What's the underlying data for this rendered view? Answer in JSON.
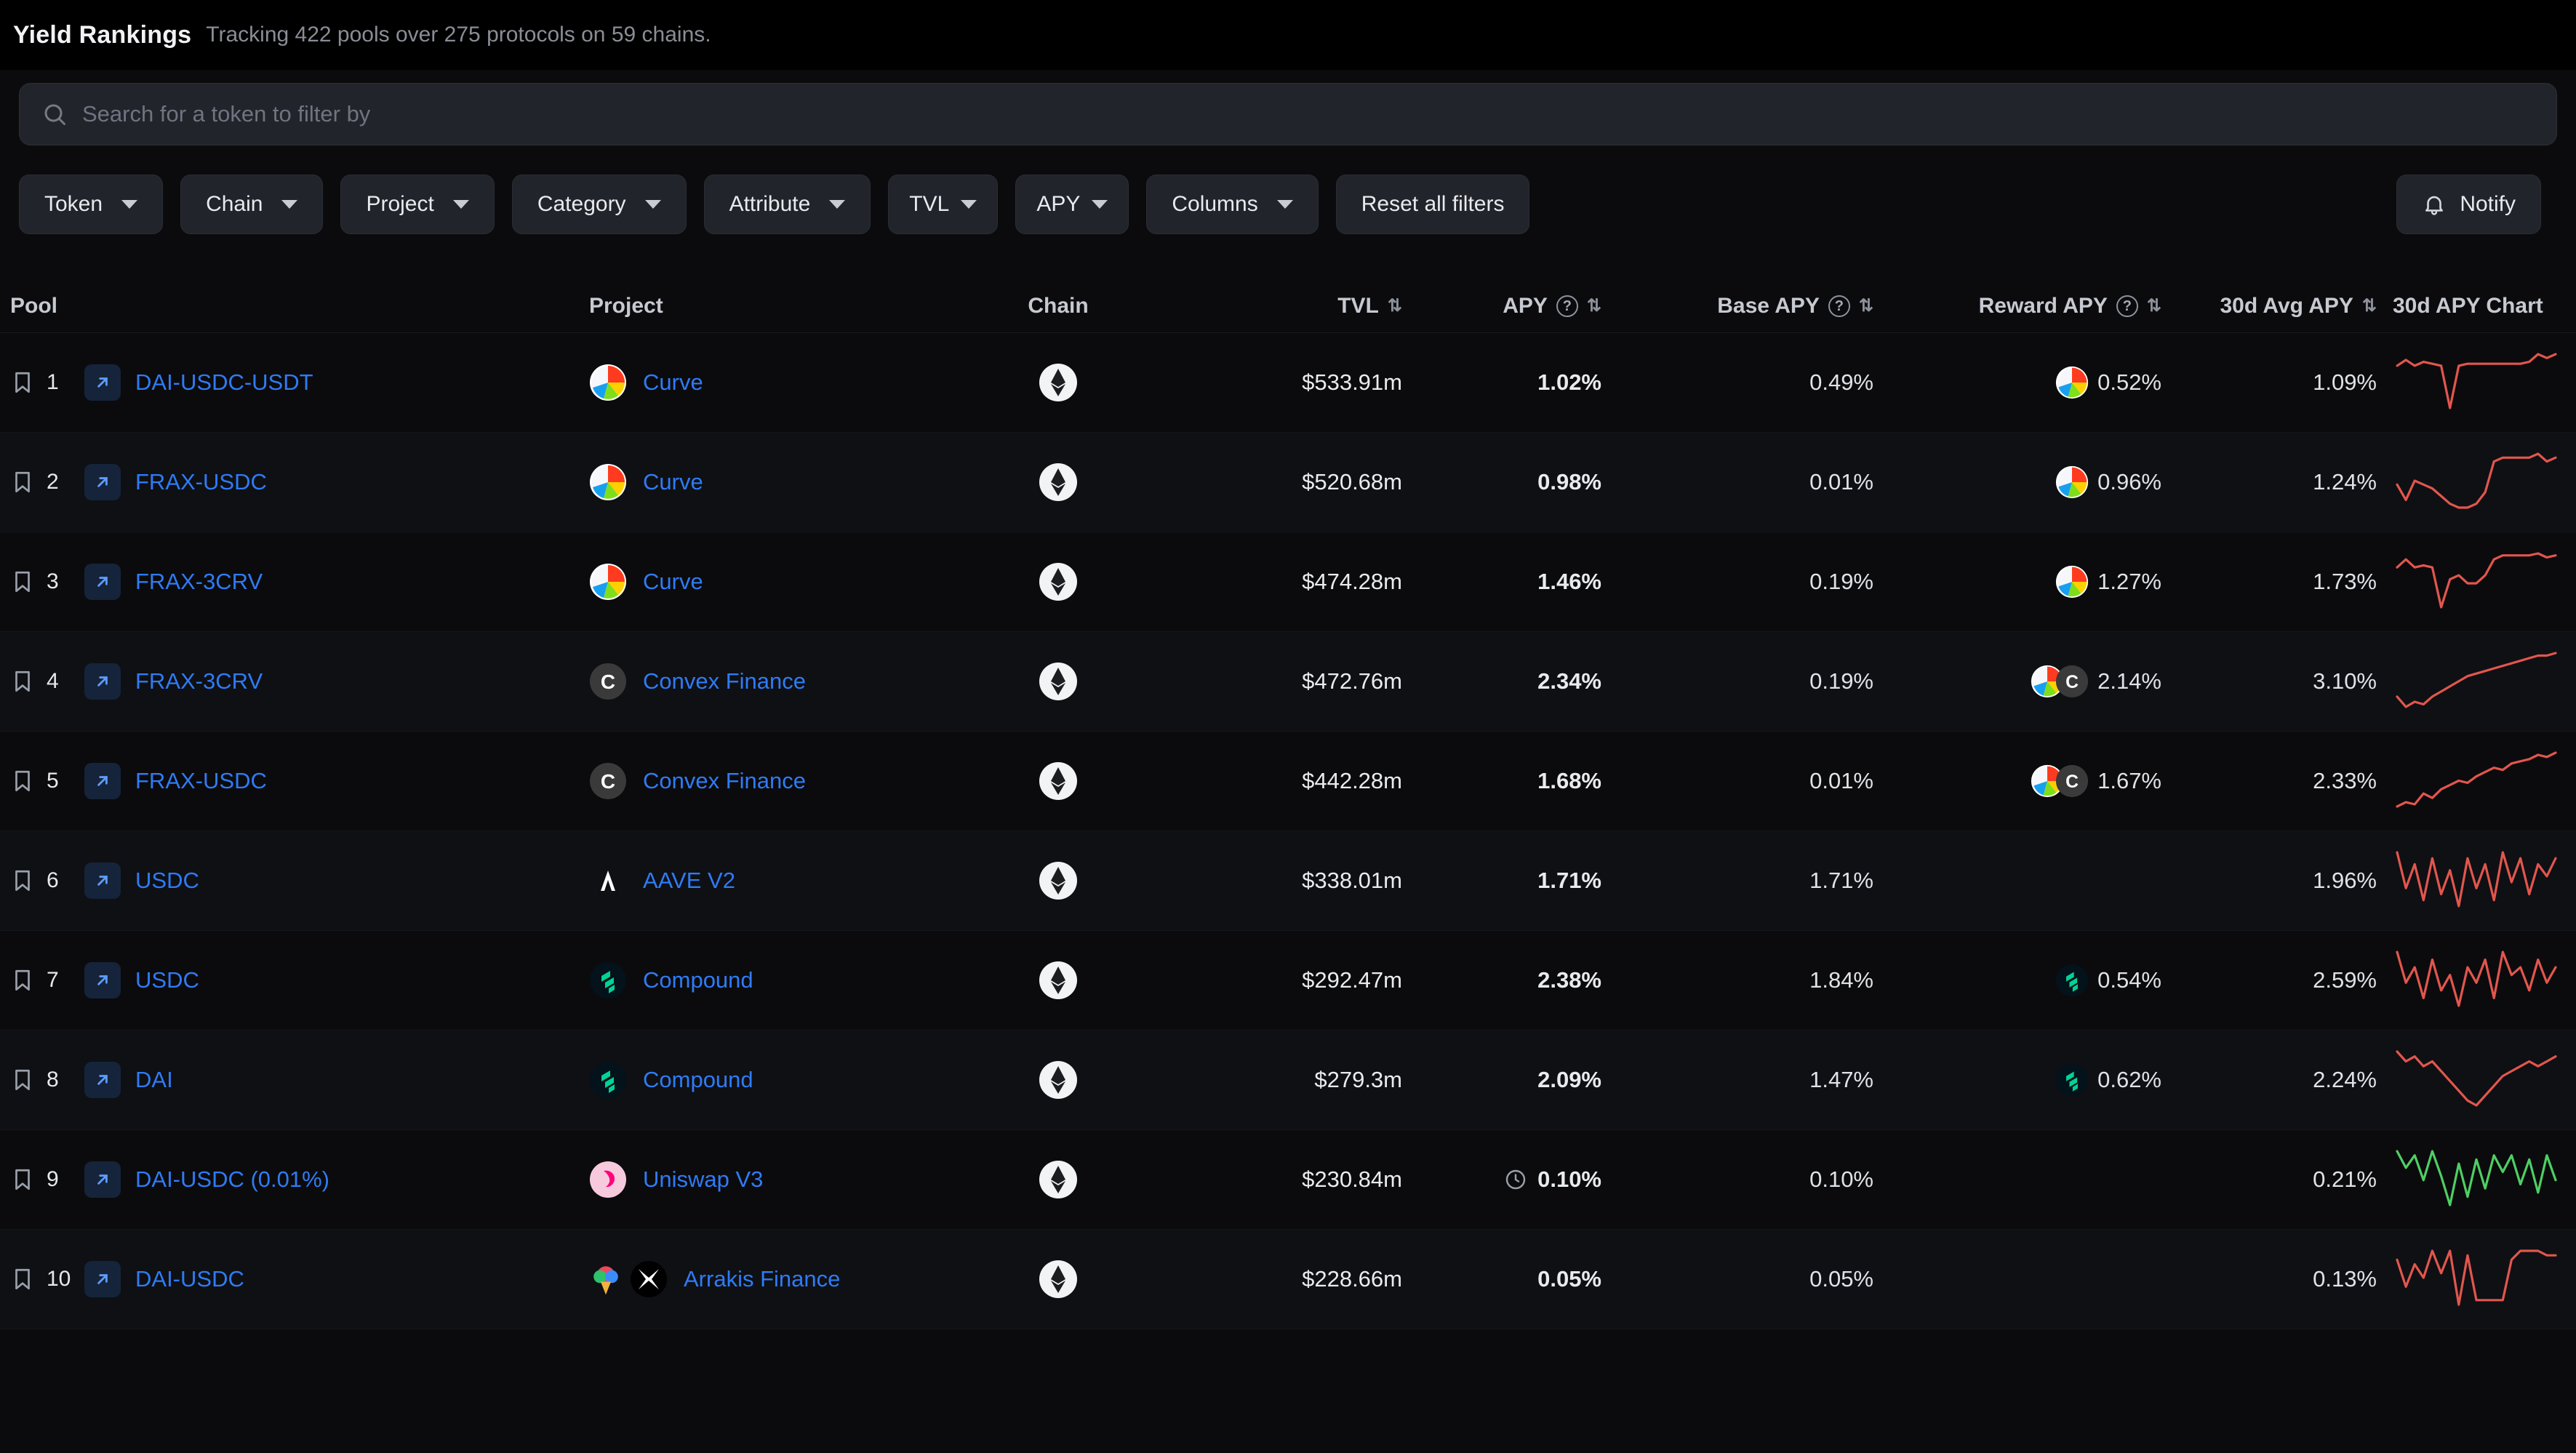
{
  "header": {
    "title": "Yield Rankings",
    "subtitle": "Tracking 422 pools over 275 protocols on 59 chains."
  },
  "search": {
    "placeholder": "Search for a token to filter by",
    "value": "",
    "icon": "search-icon"
  },
  "filters": {
    "chips": [
      {
        "label": "Token",
        "caret": true
      },
      {
        "label": "Chain",
        "caret": true
      },
      {
        "label": "Project",
        "caret": true
      },
      {
        "label": "Category",
        "caret": true
      },
      {
        "label": "Attribute",
        "caret": true
      },
      {
        "label": "TVL",
        "caret": true
      },
      {
        "label": "APY",
        "caret": true
      },
      {
        "label": "Columns",
        "caret": true
      }
    ],
    "reset_label": "Reset all filters",
    "notify_label": "Notify",
    "notify_icon": "bell-icon"
  },
  "table": {
    "columns": [
      {
        "key": "pool",
        "label": "Pool",
        "sortable": false,
        "info": false
      },
      {
        "key": "proj",
        "label": "Project",
        "sortable": false,
        "info": false
      },
      {
        "key": "chain",
        "label": "Chain",
        "sortable": false,
        "info": false
      },
      {
        "key": "tvl",
        "label": "TVL",
        "sortable": true,
        "info": false
      },
      {
        "key": "apy",
        "label": "APY",
        "sortable": true,
        "info": true
      },
      {
        "key": "base",
        "label": "Base APY",
        "sortable": true,
        "info": true
      },
      {
        "key": "rew",
        "label": "Reward APY",
        "sortable": true,
        "info": true
      },
      {
        "key": "avg",
        "label": "30d Avg APY",
        "sortable": true,
        "info": false
      },
      {
        "key": "chart",
        "label": "30d APY Chart",
        "sortable": false,
        "info": false
      }
    ],
    "rows": [
      {
        "rank": "1",
        "pool": "DAI-USDC-USDT",
        "project": "Curve",
        "project_logo": "curve-logo",
        "project_logo2": "",
        "chain": "Ethereum",
        "tvl": "$533.91m",
        "apy": "1.02%",
        "apy_flag": false,
        "base": "0.49%",
        "reward": "0.52%",
        "reward_logos": [
          "curve-logo"
        ],
        "avg": "1.09%",
        "spark_color": "#e2564d",
        "spark": [
          30,
          33,
          30,
          32,
          31,
          30,
          8,
          30,
          31,
          31,
          31,
          31,
          31,
          31,
          31,
          32,
          36,
          34,
          36
        ]
      },
      {
        "rank": "2",
        "pool": "FRAX-USDC",
        "project": "Curve",
        "project_logo": "curve-logo",
        "project_logo2": "",
        "chain": "Ethereum",
        "tvl": "$520.68m",
        "apy": "0.98%",
        "apy_flag": false,
        "base": "0.01%",
        "reward": "0.96%",
        "reward_logos": [
          "curve-logo"
        ],
        "avg": "1.24%",
        "spark_color": "#e2564d",
        "spark": [
          26,
          22,
          27,
          26,
          25,
          23,
          21,
          20,
          20,
          21,
          24,
          32,
          33,
          33,
          33,
          33,
          34,
          32,
          33
        ]
      },
      {
        "rank": "3",
        "pool": "FRAX-3CRV",
        "project": "Curve",
        "project_logo": "curve-logo",
        "project_logo2": "",
        "chain": "Ethereum",
        "tvl": "$474.28m",
        "apy": "1.46%",
        "apy_flag": false,
        "base": "0.19%",
        "reward": "1.27%",
        "reward_logos": [
          "curve-logo"
        ],
        "avg": "1.73%",
        "spark_color": "#e2564d",
        "spark": [
          30,
          34,
          30,
          31,
          30,
          10,
          24,
          26,
          22,
          22,
          26,
          34,
          36,
          36,
          36,
          36,
          37,
          35,
          36
        ]
      },
      {
        "rank": "4",
        "pool": "FRAX-3CRV",
        "project": "Convex Finance",
        "project_logo": "convex-logo",
        "project_logo2": "",
        "chain": "Ethereum",
        "tvl": "$472.76m",
        "apy": "2.34%",
        "apy_flag": false,
        "base": "0.19%",
        "reward": "2.14%",
        "reward_logos": [
          "curve-logo",
          "convex-logo"
        ],
        "avg": "3.10%",
        "spark_color": "#e2564d",
        "spark": [
          18,
          14,
          16,
          15,
          18,
          20,
          22,
          24,
          26,
          27,
          28,
          29,
          30,
          31,
          32,
          33,
          34,
          34,
          35
        ]
      },
      {
        "rank": "5",
        "pool": "FRAX-USDC",
        "project": "Convex Finance",
        "project_logo": "convex-logo",
        "project_logo2": "",
        "chain": "Ethereum",
        "tvl": "$442.28m",
        "apy": "1.68%",
        "apy_flag": false,
        "base": "0.01%",
        "reward": "1.67%",
        "reward_logos": [
          "curve-logo",
          "convex-logo"
        ],
        "avg": "2.33%",
        "spark_color": "#e2564d",
        "spark": [
          12,
          14,
          13,
          18,
          16,
          20,
          22,
          24,
          23,
          26,
          28,
          30,
          29,
          32,
          33,
          34,
          36,
          35,
          37
        ]
      },
      {
        "rank": "6",
        "pool": "USDC",
        "project": "AAVE V2",
        "project_logo": "aave-logo",
        "project_logo2": "",
        "chain": "Ethereum",
        "tvl": "$338.01m",
        "apy": "1.71%",
        "apy_flag": false,
        "base": "1.71%",
        "reward": "",
        "reward_logos": [],
        "avg": "1.96%",
        "spark_color": "#e2564d",
        "spark": [
          32,
          20,
          28,
          16,
          30,
          18,
          26,
          14,
          30,
          20,
          28,
          16,
          32,
          22,
          30,
          18,
          28,
          24,
          30
        ]
      },
      {
        "rank": "7",
        "pool": "USDC",
        "project": "Compound",
        "project_logo": "compound-logo",
        "project_logo2": "",
        "chain": "Ethereum",
        "tvl": "$292.47m",
        "apy": "2.38%",
        "apy_flag": false,
        "base": "1.84%",
        "reward": "0.54%",
        "reward_logos": [
          "compound-logo"
        ],
        "avg": "2.59%",
        "spark_color": "#e2564d",
        "spark": [
          30,
          22,
          26,
          18,
          28,
          20,
          24,
          16,
          26,
          22,
          28,
          18,
          30,
          24,
          26,
          20,
          28,
          22,
          26
        ]
      },
      {
        "rank": "8",
        "pool": "DAI",
        "project": "Compound",
        "project_logo": "compound-logo",
        "project_logo2": "",
        "chain": "Ethereum",
        "tvl": "$279.3m",
        "apy": "2.09%",
        "apy_flag": false,
        "base": "1.47%",
        "reward": "0.62%",
        "reward_logos": [
          "compound-logo"
        ],
        "avg": "2.24%",
        "spark_color": "#e2564d",
        "spark": [
          34,
          30,
          32,
          28,
          30,
          26,
          22,
          18,
          14,
          12,
          16,
          20,
          24,
          26,
          28,
          30,
          28,
          30,
          32
        ]
      },
      {
        "rank": "9",
        "pool": "DAI-USDC (0.01%)",
        "project": "Uniswap V3",
        "project_logo": "uniswap-logo",
        "project_logo2": "",
        "chain": "Ethereum",
        "tvl": "$230.84m",
        "apy": "0.10%",
        "apy_flag": true,
        "base": "0.10%",
        "reward": "",
        "reward_logos": [],
        "avg": "0.21%",
        "spark_color": "#4ecf63",
        "spark": [
          32,
          24,
          30,
          18,
          32,
          20,
          6,
          26,
          10,
          28,
          14,
          30,
          22,
          30,
          16,
          28,
          12,
          30,
          18
        ]
      },
      {
        "rank": "10",
        "pool": "DAI-USDC",
        "project": "Arrakis Finance",
        "project_logo": "arrakis-logo",
        "project_logo2": "gelato-logo",
        "chain": "Ethereum",
        "tvl": "$228.66m",
        "apy": "0.05%",
        "apy_flag": false,
        "base": "0.05%",
        "reward": "",
        "reward_logos": [],
        "avg": "0.13%",
        "spark_color": "#e2564d",
        "spark": [
          30,
          18,
          28,
          22,
          34,
          24,
          34,
          10,
          32,
          12,
          12,
          12,
          12,
          30,
          34,
          34,
          34,
          32,
          32
        ]
      }
    ]
  },
  "colors": {
    "accent_link": "#2f7bf6",
    "background": "#0b0b0d",
    "row_alt": "#0e1014",
    "chip_bg": "#22242b",
    "spark_up": "#4ecf63",
    "spark_down": "#e2564d"
  }
}
